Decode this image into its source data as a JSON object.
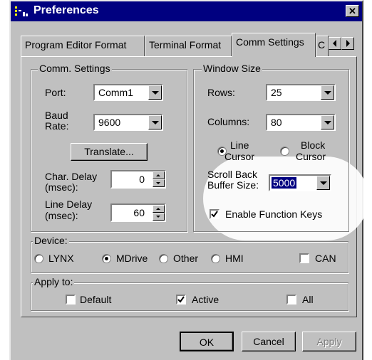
{
  "window": {
    "title": "Preferences",
    "close_glyph": "✕"
  },
  "tabs": {
    "items": [
      {
        "label": "Program Editor Format"
      },
      {
        "label": "Terminal Format"
      },
      {
        "label": "Comm Settings"
      },
      {
        "label": "C"
      }
    ]
  },
  "comm": {
    "group_label": "Comm. Settings",
    "port_label": "Port:",
    "port_value": "Comm1",
    "baud_label_1": "Baud",
    "baud_label_2": "Rate:",
    "baud_value": "9600",
    "translate_label": "Translate...",
    "char_delay_label_1": "Char. Delay",
    "char_delay_label_2": "(msec):",
    "char_delay_value": "0",
    "line_delay_label_1": "Line Delay",
    "line_delay_label_2": "(msec):",
    "line_delay_value": "60"
  },
  "window_size": {
    "group_label": "Window Size",
    "rows_label": "Rows:",
    "rows_value": "25",
    "columns_label": "Columns:",
    "columns_value": "80",
    "line_cursor_1": "Line",
    "line_cursor_2": "Cursor",
    "block_cursor_1": "Block",
    "block_cursor_2": "Cursor",
    "scroll_label_1": "Scroll Back",
    "scroll_label_2": "Buffer Size:",
    "scroll_value": "5000",
    "enable_fn_label": "Enable Function Keys"
  },
  "device": {
    "group_label": "Device:",
    "options": [
      "LYNX",
      "MDrive",
      "Other",
      "HMI"
    ],
    "selected": "MDrive",
    "can_label": "CAN"
  },
  "apply_to": {
    "group_label": "Apply to:",
    "default_label": "Default",
    "active_label": "Active",
    "all_label": "All"
  },
  "buttons": {
    "ok": "OK",
    "cancel": "Cancel",
    "apply": "Apply"
  },
  "colors": {
    "titlebar": "#000080",
    "face": "#c0c0c0",
    "selection": "#000080"
  }
}
